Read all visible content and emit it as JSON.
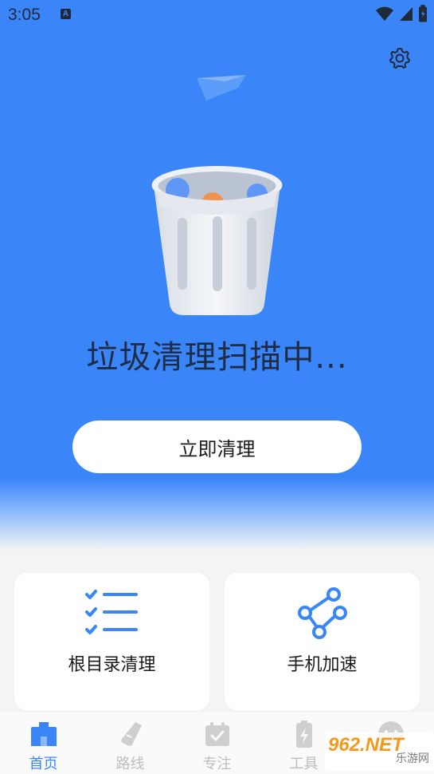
{
  "status_bar": {
    "time": "3:05",
    "badge": "A"
  },
  "hero": {
    "scan_text": "垃圾清理扫描中...",
    "clean_button": "立即清理"
  },
  "cards": [
    {
      "label": "根目录清理",
      "icon": "checklist-icon"
    },
    {
      "label": "手机加速",
      "icon": "share-nodes-icon"
    }
  ],
  "tabs": [
    {
      "label": "首页",
      "icon": "home-icon",
      "active": true
    },
    {
      "label": "路线",
      "icon": "shoe-icon",
      "active": false
    },
    {
      "label": "专注",
      "icon": "calendar-check-icon",
      "active": false
    },
    {
      "label": "工具",
      "icon": "battery-icon",
      "active": false
    },
    {
      "label": "",
      "icon": "face-icon",
      "active": false
    }
  ],
  "watermark": {
    "main": "962.NET",
    "sub": "乐游网"
  },
  "colors": {
    "accent": "#3a86f8",
    "text_dark": "#1e2c47",
    "tab_inactive": "#bdbdbd"
  }
}
